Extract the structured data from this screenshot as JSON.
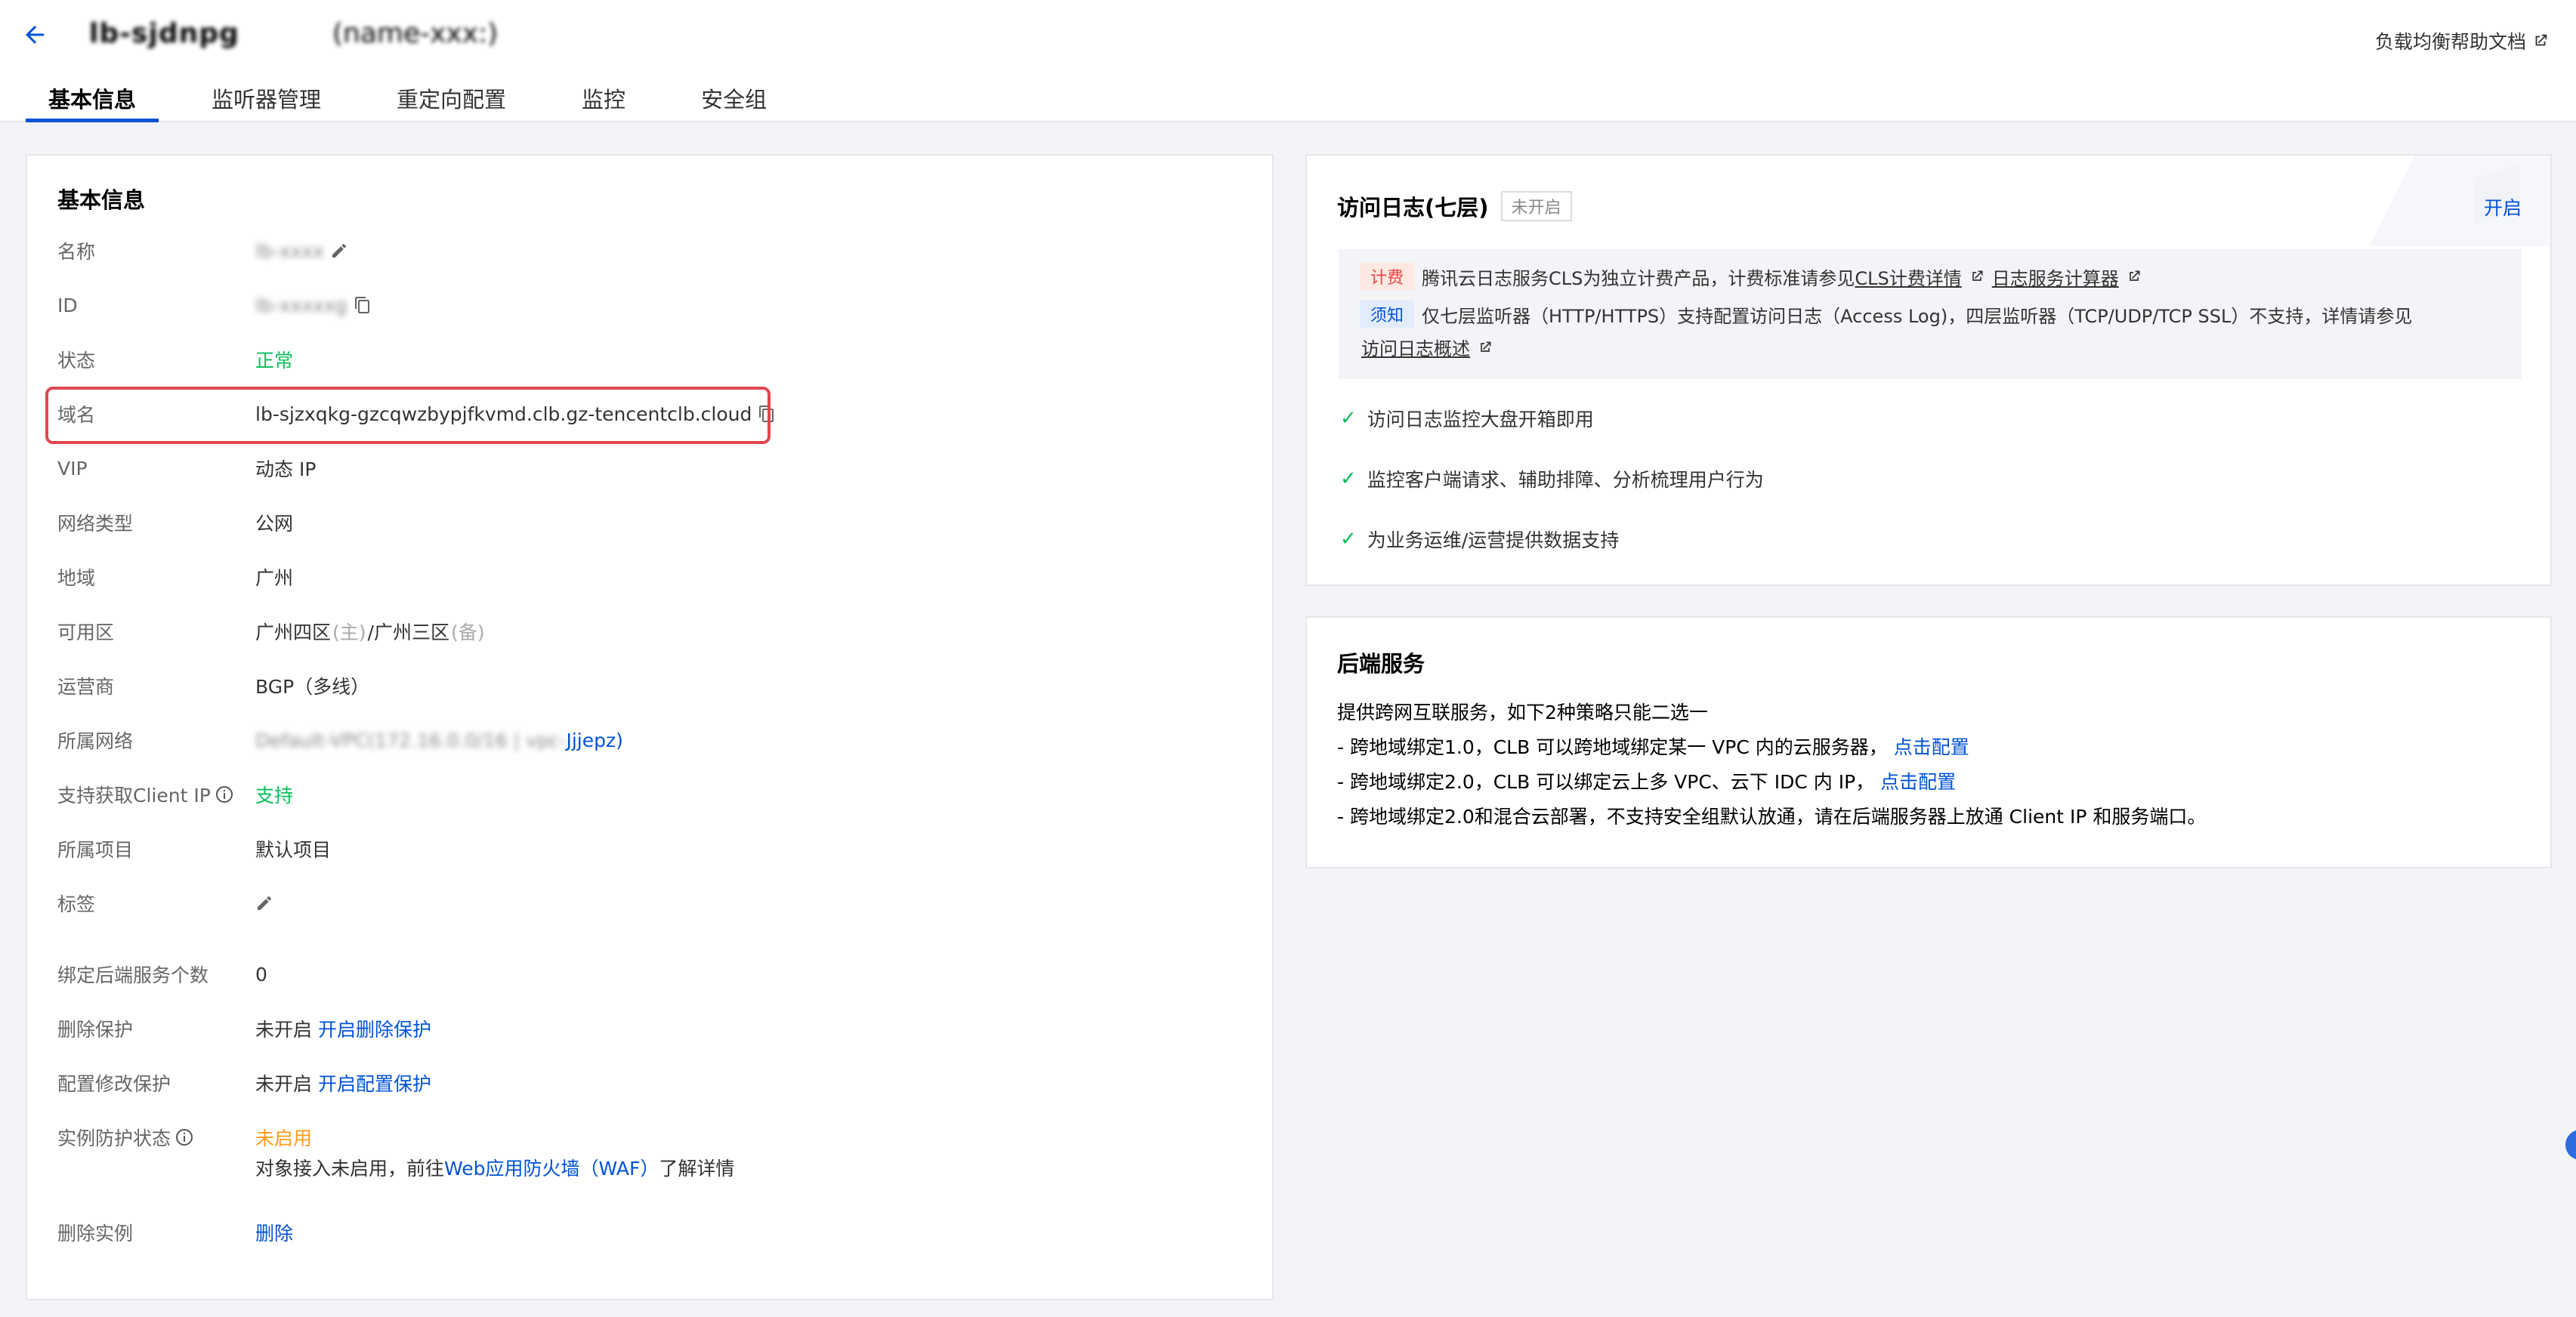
{
  "header": {
    "title_blurred": "lb-sjdnpg",
    "title_suffix": "(name-xxx:)",
    "help_link": "负载均衡帮助文档"
  },
  "tabs": [
    {
      "label": "基本信息",
      "active": true
    },
    {
      "label": "监听器管理",
      "active": false
    },
    {
      "label": "重定向配置",
      "active": false
    },
    {
      "label": "监控",
      "active": false
    },
    {
      "label": "安全组",
      "active": false
    }
  ],
  "basic": {
    "title": "基本信息",
    "rows": {
      "name": {
        "label": "名称",
        "value": "lb-xxxx"
      },
      "id": {
        "label": "ID",
        "value": "lb-xxxxxg"
      },
      "status": {
        "label": "状态",
        "value": "正常"
      },
      "domain": {
        "label": "域名",
        "value_blur": "lb-sjzxqkg-gzcqwzbypjfkvmd",
        "value": "lb-sjzxqkg-gzcqwzbypjfkvmd.clb.gz-tencentclb.cloud"
      },
      "vip": {
        "label": "VIP",
        "value": "动态 IP"
      },
      "network_type": {
        "label": "网络类型",
        "value": "公网"
      },
      "region": {
        "label": "地域",
        "value": "广州"
      },
      "zone": {
        "label": "可用区",
        "value_main": "广州四区",
        "main_tag": "(主)",
        "value_backup": "/广州三区",
        "backup_tag": "(备)"
      },
      "isp": {
        "label": "运营商",
        "value": "BGP（多线）"
      },
      "vpc": {
        "label": "所属网络",
        "value_blur": "Default-VPC(172.16.0.0/16 | vpc-",
        "value_link": "Jjjepz)"
      },
      "client_ip": {
        "label": "支持获取Client IP",
        "value": "支持"
      },
      "project": {
        "label": "所属项目",
        "value": "默认项目"
      },
      "tags": {
        "label": "标签"
      },
      "backend_count": {
        "label": "绑定后端服务个数",
        "value": "0"
      },
      "delete_protect": {
        "label": "删除保护",
        "value": "未开启",
        "link": "开启删除保护"
      },
      "config_protect": {
        "label": "配置修改保护",
        "value": "未开启",
        "link": "开启配置保护"
      },
      "instance_protect": {
        "label": "实例防护状态",
        "value": "未启用",
        "desc_prefix": "对象接入未启用，前往",
        "desc_link": "Web应用防火墙（WAF）",
        "desc_suffix": "了解详情"
      },
      "delete_instance": {
        "label": "删除实例",
        "link": "删除"
      }
    }
  },
  "access_log": {
    "title": "访问日志(七层)",
    "badge": "未开启",
    "enable": "开启",
    "fee_tag": "计费",
    "fee_text": "腾讯云日志服务CLS为独立计费产品，计费标准请参见",
    "fee_link1": "CLS计费详情",
    "fee_link2": "日志服务计算器",
    "note_tag": "须知",
    "note_text": "仅七层监听器（HTTP/HTTPS）支持配置访问日志（Access Log)，四层监听器（TCP/UDP/TCP SSL）不支持，详情请参见",
    "note_link": "访问日志概述",
    "features": [
      "访问日志监控大盘开箱即用",
      "监控客户端请求、辅助排障、分析梳理用户行为",
      "为业务运维/运营提供数据支持"
    ]
  },
  "backend": {
    "title": "后端服务",
    "intro": "提供跨网互联服务，如下2种策略只能二选一",
    "line1": "- 跨地域绑定1.0，CLB 可以跨地域绑定某一 VPC 内的云服务器，",
    "line1_link": "点击配置",
    "line2": "- 跨地域绑定2.0，CLB 可以绑定云上多 VPC、云下 IDC 内 IP，",
    "line2_link": "点击配置",
    "line3": "- 跨地域绑定2.0和混合云部署，不支持安全组默认放通，请在后端服务器上放通 Client IP 和服务端口。"
  }
}
